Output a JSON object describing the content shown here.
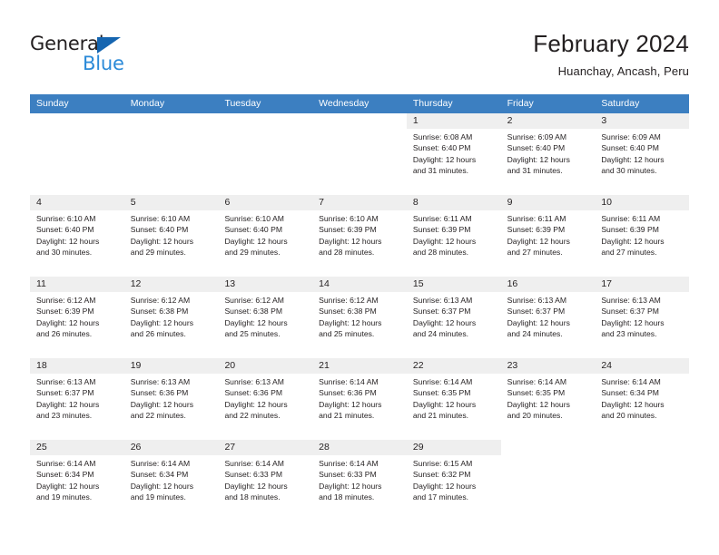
{
  "brand": {
    "name_part1": "General",
    "name_part2": "Blue",
    "triangle_color": "#1565b0",
    "blue_color": "#2b8ad8"
  },
  "header": {
    "title": "February 2024",
    "subtitle": "Huanchay, Ancash, Peru"
  },
  "theme": {
    "header_row_bg": "#3c7fc1",
    "row_rule": "#1f6bb0",
    "daynum_band_bg": "#efefef",
    "text": "#231f20"
  },
  "weekdays": [
    "Sunday",
    "Monday",
    "Tuesday",
    "Wednesday",
    "Thursday",
    "Friday",
    "Saturday"
  ],
  "weeks": [
    [
      {
        "day": "",
        "lines": []
      },
      {
        "day": "",
        "lines": []
      },
      {
        "day": "",
        "lines": []
      },
      {
        "day": "",
        "lines": []
      },
      {
        "day": "1",
        "lines": [
          "Sunrise: 6:08 AM",
          "Sunset: 6:40 PM",
          "Daylight: 12 hours",
          "and 31 minutes."
        ]
      },
      {
        "day": "2",
        "lines": [
          "Sunrise: 6:09 AM",
          "Sunset: 6:40 PM",
          "Daylight: 12 hours",
          "and 31 minutes."
        ]
      },
      {
        "day": "3",
        "lines": [
          "Sunrise: 6:09 AM",
          "Sunset: 6:40 PM",
          "Daylight: 12 hours",
          "and 30 minutes."
        ]
      }
    ],
    [
      {
        "day": "4",
        "lines": [
          "Sunrise: 6:10 AM",
          "Sunset: 6:40 PM",
          "Daylight: 12 hours",
          "and 30 minutes."
        ]
      },
      {
        "day": "5",
        "lines": [
          "Sunrise: 6:10 AM",
          "Sunset: 6:40 PM",
          "Daylight: 12 hours",
          "and 29 minutes."
        ]
      },
      {
        "day": "6",
        "lines": [
          "Sunrise: 6:10 AM",
          "Sunset: 6:40 PM",
          "Daylight: 12 hours",
          "and 29 minutes."
        ]
      },
      {
        "day": "7",
        "lines": [
          "Sunrise: 6:10 AM",
          "Sunset: 6:39 PM",
          "Daylight: 12 hours",
          "and 28 minutes."
        ]
      },
      {
        "day": "8",
        "lines": [
          "Sunrise: 6:11 AM",
          "Sunset: 6:39 PM",
          "Daylight: 12 hours",
          "and 28 minutes."
        ]
      },
      {
        "day": "9",
        "lines": [
          "Sunrise: 6:11 AM",
          "Sunset: 6:39 PM",
          "Daylight: 12 hours",
          "and 27 minutes."
        ]
      },
      {
        "day": "10",
        "lines": [
          "Sunrise: 6:11 AM",
          "Sunset: 6:39 PM",
          "Daylight: 12 hours",
          "and 27 minutes."
        ]
      }
    ],
    [
      {
        "day": "11",
        "lines": [
          "Sunrise: 6:12 AM",
          "Sunset: 6:39 PM",
          "Daylight: 12 hours",
          "and 26 minutes."
        ]
      },
      {
        "day": "12",
        "lines": [
          "Sunrise: 6:12 AM",
          "Sunset: 6:38 PM",
          "Daylight: 12 hours",
          "and 26 minutes."
        ]
      },
      {
        "day": "13",
        "lines": [
          "Sunrise: 6:12 AM",
          "Sunset: 6:38 PM",
          "Daylight: 12 hours",
          "and 25 minutes."
        ]
      },
      {
        "day": "14",
        "lines": [
          "Sunrise: 6:12 AM",
          "Sunset: 6:38 PM",
          "Daylight: 12 hours",
          "and 25 minutes."
        ]
      },
      {
        "day": "15",
        "lines": [
          "Sunrise: 6:13 AM",
          "Sunset: 6:37 PM",
          "Daylight: 12 hours",
          "and 24 minutes."
        ]
      },
      {
        "day": "16",
        "lines": [
          "Sunrise: 6:13 AM",
          "Sunset: 6:37 PM",
          "Daylight: 12 hours",
          "and 24 minutes."
        ]
      },
      {
        "day": "17",
        "lines": [
          "Sunrise: 6:13 AM",
          "Sunset: 6:37 PM",
          "Daylight: 12 hours",
          "and 23 minutes."
        ]
      }
    ],
    [
      {
        "day": "18",
        "lines": [
          "Sunrise: 6:13 AM",
          "Sunset: 6:37 PM",
          "Daylight: 12 hours",
          "and 23 minutes."
        ]
      },
      {
        "day": "19",
        "lines": [
          "Sunrise: 6:13 AM",
          "Sunset: 6:36 PM",
          "Daylight: 12 hours",
          "and 22 minutes."
        ]
      },
      {
        "day": "20",
        "lines": [
          "Sunrise: 6:13 AM",
          "Sunset: 6:36 PM",
          "Daylight: 12 hours",
          "and 22 minutes."
        ]
      },
      {
        "day": "21",
        "lines": [
          "Sunrise: 6:14 AM",
          "Sunset: 6:36 PM",
          "Daylight: 12 hours",
          "and 21 minutes."
        ]
      },
      {
        "day": "22",
        "lines": [
          "Sunrise: 6:14 AM",
          "Sunset: 6:35 PM",
          "Daylight: 12 hours",
          "and 21 minutes."
        ]
      },
      {
        "day": "23",
        "lines": [
          "Sunrise: 6:14 AM",
          "Sunset: 6:35 PM",
          "Daylight: 12 hours",
          "and 20 minutes."
        ]
      },
      {
        "day": "24",
        "lines": [
          "Sunrise: 6:14 AM",
          "Sunset: 6:34 PM",
          "Daylight: 12 hours",
          "and 20 minutes."
        ]
      }
    ],
    [
      {
        "day": "25",
        "lines": [
          "Sunrise: 6:14 AM",
          "Sunset: 6:34 PM",
          "Daylight: 12 hours",
          "and 19 minutes."
        ]
      },
      {
        "day": "26",
        "lines": [
          "Sunrise: 6:14 AM",
          "Sunset: 6:34 PM",
          "Daylight: 12 hours",
          "and 19 minutes."
        ]
      },
      {
        "day": "27",
        "lines": [
          "Sunrise: 6:14 AM",
          "Sunset: 6:33 PM",
          "Daylight: 12 hours",
          "and 18 minutes."
        ]
      },
      {
        "day": "28",
        "lines": [
          "Sunrise: 6:14 AM",
          "Sunset: 6:33 PM",
          "Daylight: 12 hours",
          "and 18 minutes."
        ]
      },
      {
        "day": "29",
        "lines": [
          "Sunrise: 6:15 AM",
          "Sunset: 6:32 PM",
          "Daylight: 12 hours",
          "and 17 minutes."
        ]
      },
      {
        "day": "",
        "lines": []
      },
      {
        "day": "",
        "lines": []
      }
    ]
  ]
}
